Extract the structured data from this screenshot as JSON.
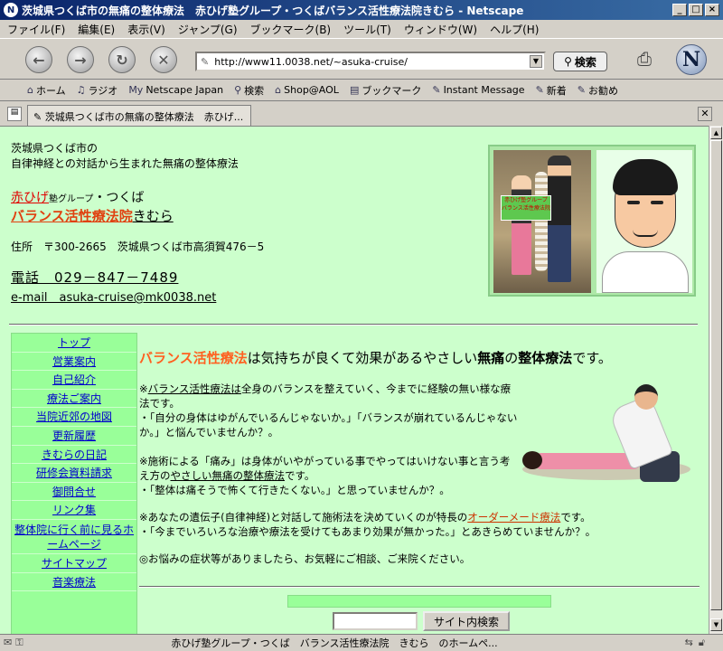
{
  "window": {
    "title": "茨城県つくば市の無痛の整体療法　赤ひげ塾グループ・つくばバランス活性療法院きむら - Netscape",
    "app_icon": "N",
    "btn_min": "_",
    "btn_max": "□",
    "btn_close": "×"
  },
  "menu": [
    "ファイル(F)",
    "編集(E)",
    "表示(V)",
    "ジャンプ(G)",
    "ブックマーク(B)",
    "ツール(T)",
    "ウィンドウ(W)",
    "ヘルプ(H)"
  ],
  "nav": {
    "url": "http://www11.0038.net/~asuka-cruise/",
    "search_label": "検索",
    "logo": "N"
  },
  "personal_toolbar": [
    {
      "icon": "⌂",
      "label": "ホーム"
    },
    {
      "icon": "♫",
      "label": "ラジオ"
    },
    {
      "icon": "My",
      "label": "Netscape Japan"
    },
    {
      "icon": "⚲",
      "label": "検索"
    },
    {
      "icon": "⌂",
      "label": "Shop@AOL"
    },
    {
      "icon": "▤",
      "label": "ブックマーク"
    },
    {
      "icon": "✎",
      "label": "Instant Message"
    },
    {
      "icon": "✎",
      "label": "新着"
    },
    {
      "icon": "✎",
      "label": "お勧め"
    }
  ],
  "tab": {
    "label": "茨城県つくば市の無痛の整体療法　赤ひげ..."
  },
  "page": {
    "intro1": "茨城県つくば市の",
    "intro2": "自律神経との対話から生まれた無痛の整体療法",
    "brand_red": "赤ひげ",
    "brand_small": "塾グループ",
    "brand_dot": "・つくば",
    "clinic": "バランス活性療法院",
    "kimura": "きむら",
    "address": "住所　〒300-2665　茨城県つくば市高須賀476－5",
    "phone": "電話　029－847－7489",
    "email": "e-mail　asuka-cruise@mk0038.net",
    "sign_text": "赤ひげ塾グループ バランス活性療法院",
    "headline_orange": "バランス活性療法",
    "headline_mid": "は気持ちが良くて効果があるやさしい",
    "headline_bold1": "無痛",
    "headline_no": "の",
    "headline_bold2": "整体療法",
    "headline_end": "です。",
    "p1_prefix": "※",
    "p1_link": "バランス活性療法は",
    "p1_rest": "全身のバランスを整えていく、今までに経験の無い様な療法です。",
    "p1_line2": "・「自分の身体はゆがんでいるんじゃないか。」「バランスが崩れているんじゃないか。」と悩んでいませんか？。",
    "p2_text": "※施術による「痛み」は身体がいやがっている事でやってはいけない事と言う考え方の",
    "p2_link": "やさしい無痛の整体療法",
    "p2_end": "です。",
    "p2_line2": "・「整体は痛そうで怖くて行きたくない。」と思っていませんか？。",
    "p3_text": "※あなたの遺伝子(自律神経)と対話して施術法を決めていくのが特長の",
    "p3_link": "オーダーメード療法",
    "p3_end": "です。",
    "p3_line2": "・「今までいろいろな治療や療法を受けてもあまり効果が無かった。」とあきらめていませんか？。",
    "p4": "◎お悩みの症状等がありましたら、お気軽にご相談、ご来院ください。",
    "search_button": "サイト内検索"
  },
  "sidenav": [
    "トップ",
    "営業案内",
    "自己紹介",
    "療法ご案内",
    "当院近郊の地図",
    "更新履歴",
    "きむらの日記",
    "研修会資料請求",
    "御問合せ",
    "リンク集",
    "整体院に行く前に見るホームページ",
    "サイトマップ",
    "音楽療法"
  ],
  "status": {
    "text": "赤ひげ塾グループ・つくば　バランス活性療法院　きむら　のホームペ..."
  },
  "colors": {
    "page_bg": "#ccffcc",
    "nav_bg": "#99ff99",
    "accent_orange": "#ff6020",
    "brand_red": "#e00000"
  }
}
